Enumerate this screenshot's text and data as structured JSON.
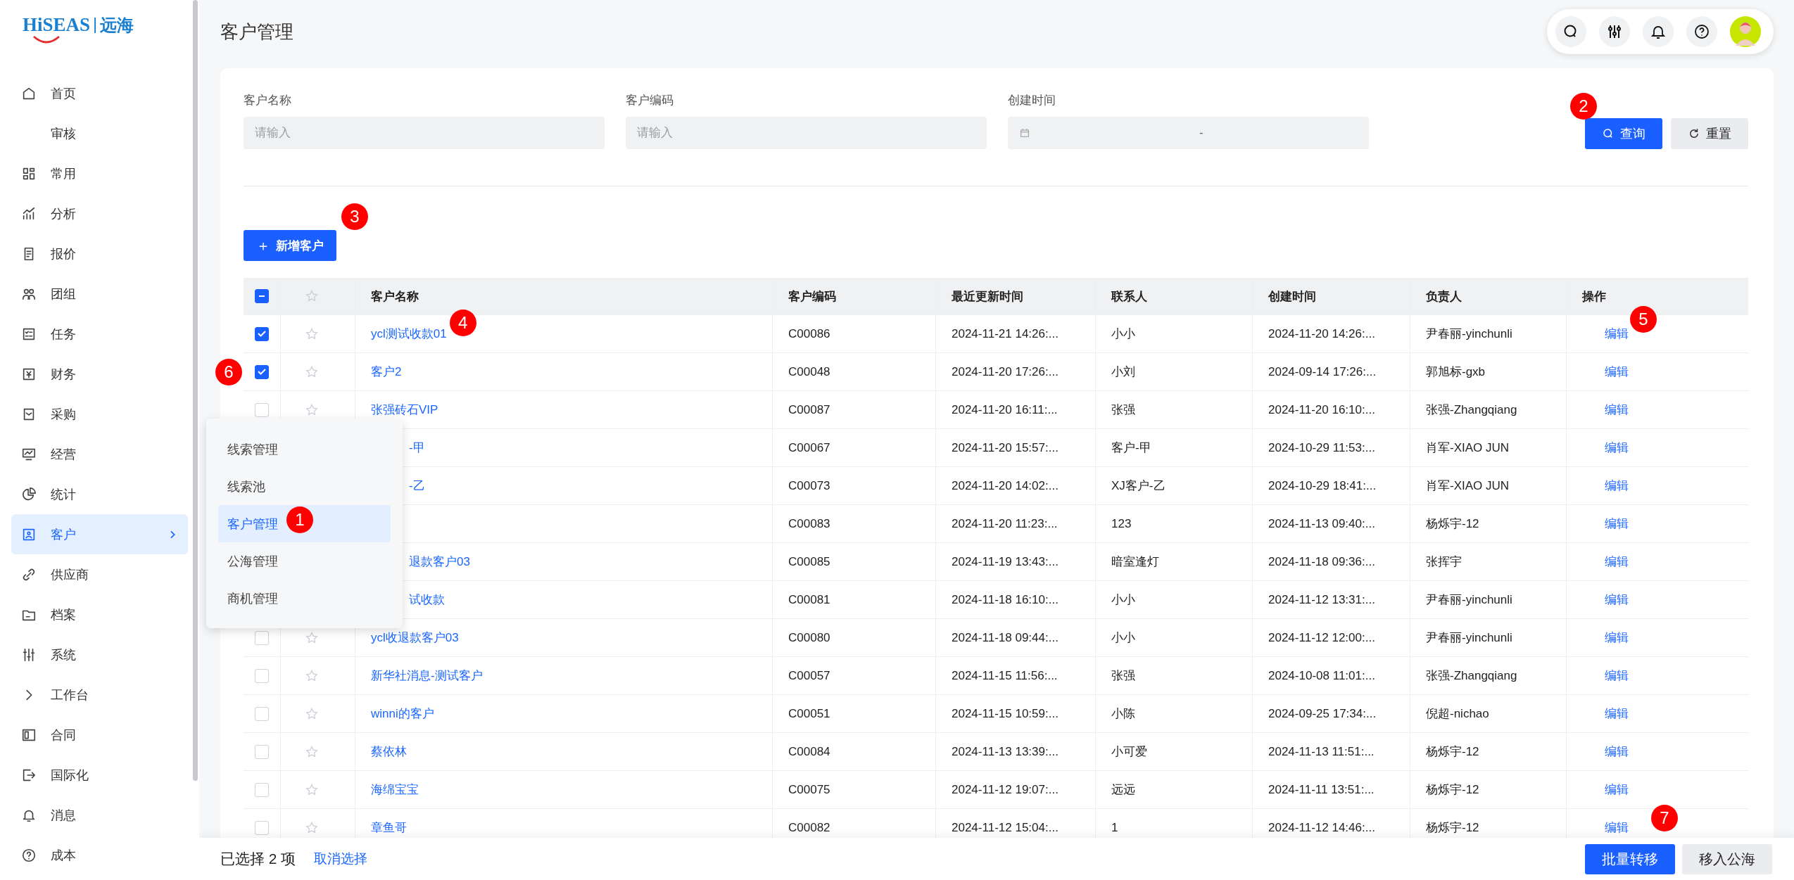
{
  "logo": {
    "brand": "HiSEAS",
    "divider": "|",
    "name": "远海"
  },
  "sidebar": {
    "items": [
      {
        "label": "首页",
        "selected": false,
        "submenu": false
      },
      {
        "label": "审核",
        "selected": false,
        "submenu": false
      },
      {
        "label": "常用",
        "selected": false,
        "submenu": false
      },
      {
        "label": "分析",
        "selected": false,
        "submenu": false
      },
      {
        "label": "报价",
        "selected": false,
        "submenu": false
      },
      {
        "label": "团组",
        "selected": false,
        "submenu": false
      },
      {
        "label": "任务",
        "selected": false,
        "submenu": false
      },
      {
        "label": "财务",
        "selected": false,
        "submenu": false
      },
      {
        "label": "采购",
        "selected": false,
        "submenu": false
      },
      {
        "label": "经营",
        "selected": false,
        "submenu": false
      },
      {
        "label": "统计",
        "selected": false,
        "submenu": false
      },
      {
        "label": "客户",
        "selected": true,
        "submenu": true
      },
      {
        "label": "供应商",
        "selected": false,
        "submenu": false
      },
      {
        "label": "档案",
        "selected": false,
        "submenu": false
      },
      {
        "label": "系统",
        "selected": false,
        "submenu": false
      },
      {
        "label": "工作台",
        "selected": false,
        "submenu": false
      },
      {
        "label": "合同",
        "selected": false,
        "submenu": false
      },
      {
        "label": "国际化",
        "selected": false,
        "submenu": false
      },
      {
        "label": "消息",
        "selected": false,
        "submenu": false
      },
      {
        "label": "成本",
        "selected": false,
        "submenu": false
      }
    ]
  },
  "flyout_menu": {
    "items": [
      {
        "label": "线索管理",
        "selected": false
      },
      {
        "label": "线索池",
        "selected": false
      },
      {
        "label": "客户管理",
        "selected": true,
        "marker": "1"
      },
      {
        "label": "公海管理",
        "selected": false
      },
      {
        "label": "商机管理",
        "selected": false
      }
    ]
  },
  "page_title": "客户管理",
  "filters": {
    "fields": [
      {
        "label": "客户名称",
        "kind": "text",
        "placeholder": "请输入"
      },
      {
        "label": "客户编码",
        "kind": "text",
        "placeholder": "请输入"
      },
      {
        "label": "创建时间",
        "kind": "date_range",
        "separator": "-"
      }
    ],
    "search_button": {
      "label": "查询",
      "marker": "2"
    },
    "reset_button": {
      "label": "重置"
    }
  },
  "add_button": {
    "label": "新增客户",
    "icon": "＋",
    "marker": "3"
  },
  "table": {
    "select_all": {
      "indeterminate": true
    },
    "columns": [
      "客户名称",
      "客户编码",
      "最近更新时间",
      "联系人",
      "创建时间",
      "负责人",
      "操作"
    ],
    "rows": [
      {
        "checked": true,
        "covered": false,
        "name": "ycl测试收款01",
        "name_marker": "4",
        "code": "C00086",
        "updated": "2024-11-21 14:26:...",
        "contact": "小小",
        "created": "2024-11-20 14:26:...",
        "owner": "尹春丽-yinchunli",
        "action": "编辑",
        "action_marker": "5"
      },
      {
        "checked": true,
        "check_marker": "6",
        "covered": false,
        "name": "客户2",
        "code": "C00048",
        "updated": "2024-11-20 17:26:...",
        "contact": "小刘",
        "created": "2024-09-14 17:26:...",
        "owner": "郭旭标-gxb",
        "action": "编辑"
      },
      {
        "checked": false,
        "covered": false,
        "name": "张强砖石VIP",
        "code": "C00087",
        "updated": "2024-11-20 16:11:...",
        "contact": "张强",
        "created": "2024-11-20 16:10:...",
        "owner": "张强-Zhangqiang",
        "action": "编辑"
      },
      {
        "covered": true,
        "name": "-甲",
        "code": "C00067",
        "updated": "2024-11-20 15:57:...",
        "contact": "客户-甲",
        "created": "2024-10-29 11:53:...",
        "owner": "肖军-XIAO JUN",
        "action": "编辑"
      },
      {
        "covered": true,
        "name": "-乙",
        "code": "C00073",
        "updated": "2024-11-20 14:02:...",
        "contact": "XJ客户-乙",
        "created": "2024-10-29 18:41:...",
        "owner": "肖军-XIAO JUN",
        "action": "编辑"
      },
      {
        "code": "C00083",
        "updated": "2024-11-20 11:23:...",
        "contact": "123",
        "created": "2024-11-13 09:40:...",
        "owner": "杨烁宇-12",
        "action": "编辑"
      },
      {
        "covered": true,
        "name": "退款客户03",
        "code": "C00085",
        "updated": "2024-11-19 13:43:...",
        "contact": "暗室逢灯",
        "created": "2024-11-18 09:36:...",
        "owner": "张挥宇",
        "action": "编辑"
      },
      {
        "covered": true,
        "name": "试收款",
        "code": "C00081",
        "updated": "2024-11-18 16:10:...",
        "contact": "小小",
        "created": "2024-11-12 13:31:...",
        "owner": "尹春丽-yinchunli",
        "action": "编辑"
      },
      {
        "checked": false,
        "covered": false,
        "name": "ycl收退款客户03",
        "code": "C00080",
        "updated": "2024-11-18 09:44:...",
        "contact": "小小",
        "created": "2024-11-12 12:00:...",
        "owner": "尹春丽-yinchunli",
        "action": "编辑"
      },
      {
        "checked": false,
        "covered": false,
        "name": "新华社消息-测试客户",
        "code": "C00057",
        "updated": "2024-11-15 11:56:...",
        "contact": "张强",
        "created": "2024-10-08 11:01:...",
        "owner": "张强-Zhangqiang",
        "action": "编辑"
      },
      {
        "checked": false,
        "covered": false,
        "name": "winni的客户",
        "code": "C00051",
        "updated": "2024-11-15 10:59:...",
        "contact": "小陈",
        "created": "2024-09-25 17:34:...",
        "owner": "倪超-nichao",
        "action": "编辑"
      },
      {
        "checked": false,
        "covered": false,
        "name": "蔡依林",
        "code": "C00084",
        "updated": "2024-11-13 13:39:...",
        "contact": "小可爱",
        "created": "2024-11-13 11:51:...",
        "owner": "杨烁宇-12",
        "action": "编辑"
      },
      {
        "checked": false,
        "covered": false,
        "name": "海绵宝宝",
        "code": "C00075",
        "updated": "2024-11-12 19:07:...",
        "contact": "远远",
        "created": "2024-11-11 13:51:...",
        "owner": "杨烁宇-12",
        "action": "编辑"
      },
      {
        "checked": false,
        "covered": false,
        "name": "章鱼哥",
        "code": "C00082",
        "updated": "2024-11-12 15:04:...",
        "contact": "1",
        "created": "2024-11-12 14:46:...",
        "owner": "杨烁宇-12",
        "action": "编辑"
      }
    ]
  },
  "selection_bar": {
    "count_text": "已选择 2 项",
    "clear_link": "取消选择",
    "buttons": [
      {
        "label": "批量转移",
        "kind": "primary",
        "marker": "7"
      },
      {
        "label": "移入公海",
        "kind": "secondary"
      }
    ]
  }
}
